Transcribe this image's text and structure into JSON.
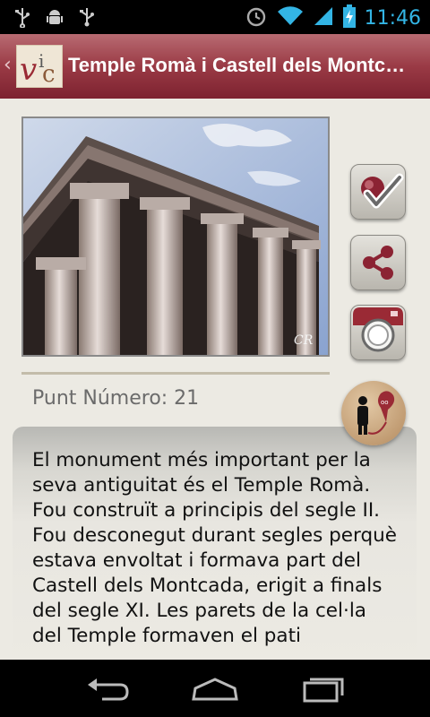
{
  "status_bar": {
    "time": "11:46",
    "icons": [
      "usb-icon",
      "android-debug-icon",
      "usb-icon",
      "alarm-icon",
      "wifi-icon",
      "signal-icon",
      "battery-charging-icon"
    ]
  },
  "action_bar": {
    "title": "Temple Romà i Castell dels Montcada",
    "logo_text": "VIC",
    "back_icon": "chevron-left-icon"
  },
  "point": {
    "label": "Punt Número: 21"
  },
  "description": "El monument més important per la seva antiguitat és el Temple Romà. Fou construït a principis del segle II. Fou desconegut durant segles perquè estava envoltat i formava part del Castell dels Montcada, erigit a finals del segle XI. Les parets de la cel·la del Temple formaven el pati",
  "actions": [
    "check-visited-icon",
    "share-icon",
    "camera-icon",
    "map-directions-icon"
  ],
  "photo_signature": "CR",
  "nav_bar": [
    "back-icon",
    "home-icon",
    "recent-apps-icon"
  ],
  "colors": {
    "accent": "#33b5e5",
    "action_bar": "#9a3a45",
    "background": "#eceae3"
  }
}
